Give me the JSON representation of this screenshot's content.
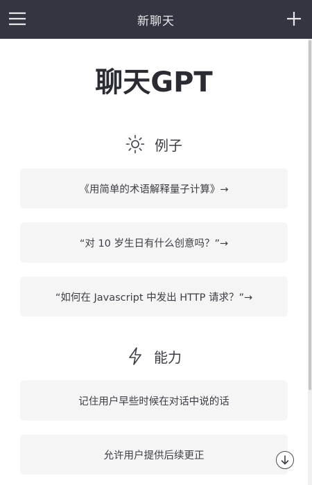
{
  "header": {
    "title": "新聊天",
    "menu_icon": "hamburger-menu-icon",
    "new_icon": "plus-icon"
  },
  "brand": {
    "title": "聊天GPT"
  },
  "examples": {
    "heading": "例子",
    "icon": "sun-icon",
    "items": [
      "《用简单的术语解释量子计算》→",
      "“对 10 岁生日有什么创意吗？”→",
      "“如何在 Javascript 中发出 HTTP 请求？”→"
    ]
  },
  "capabilities": {
    "heading": "能力",
    "icon": "lightning-icon",
    "items": [
      "记住用户早些时候在对话中说的话",
      "允许用户提供后续更正"
    ]
  },
  "scroll_down": {
    "icon": "arrow-down-icon"
  },
  "colors": {
    "topbar": "#343541",
    "card": "#f5f5f6",
    "text": "#343541"
  }
}
